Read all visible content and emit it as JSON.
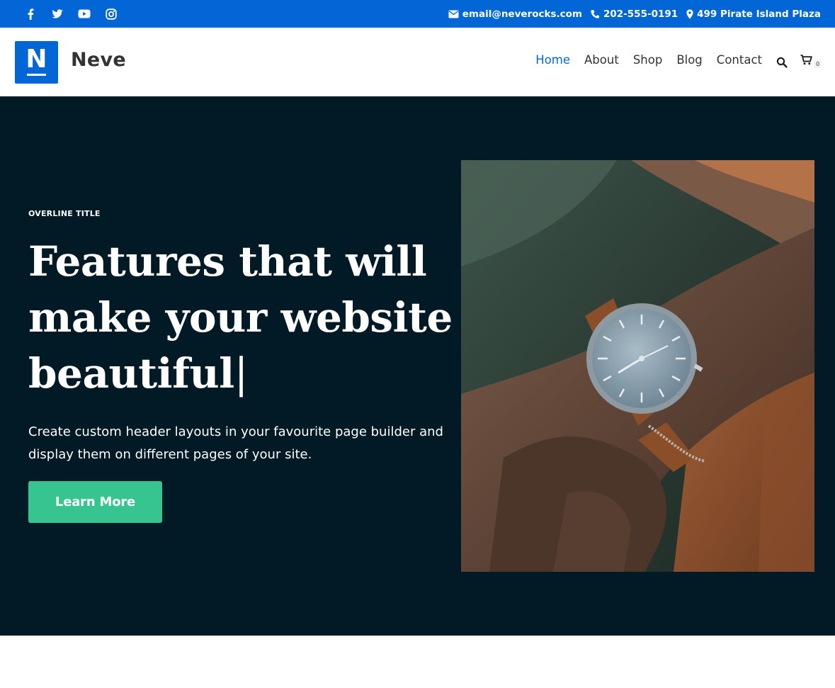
{
  "topbar": {
    "social": [
      {
        "icon": "facebook-icon"
      },
      {
        "icon": "twitter-icon"
      },
      {
        "icon": "youtube-icon"
      },
      {
        "icon": "instagram-icon"
      }
    ],
    "email": "email@neverocks.com",
    "phone": "202-555-0191",
    "address": "499 Pirate Island Plaza",
    "color": "#0366d6"
  },
  "header": {
    "logo_letter": "N",
    "brand": "Neve",
    "nav": [
      {
        "label": "Home",
        "active": true
      },
      {
        "label": "About",
        "active": false
      },
      {
        "label": "Shop",
        "active": false
      },
      {
        "label": "Blog",
        "active": false
      },
      {
        "label": "Contact",
        "active": false
      }
    ],
    "cart_count": "0"
  },
  "hero": {
    "overline": "OVERLINE TITLE",
    "headline_line1": "Features that will",
    "headline_line2": "make your website",
    "headline_line3": "beautiful",
    "caret": "|",
    "description": "Create custom header layouts in your favourite page builder and display them on different pages of your site.",
    "cta_label": "Learn More",
    "background": "#011a26",
    "cta_color": "#36c490"
  }
}
